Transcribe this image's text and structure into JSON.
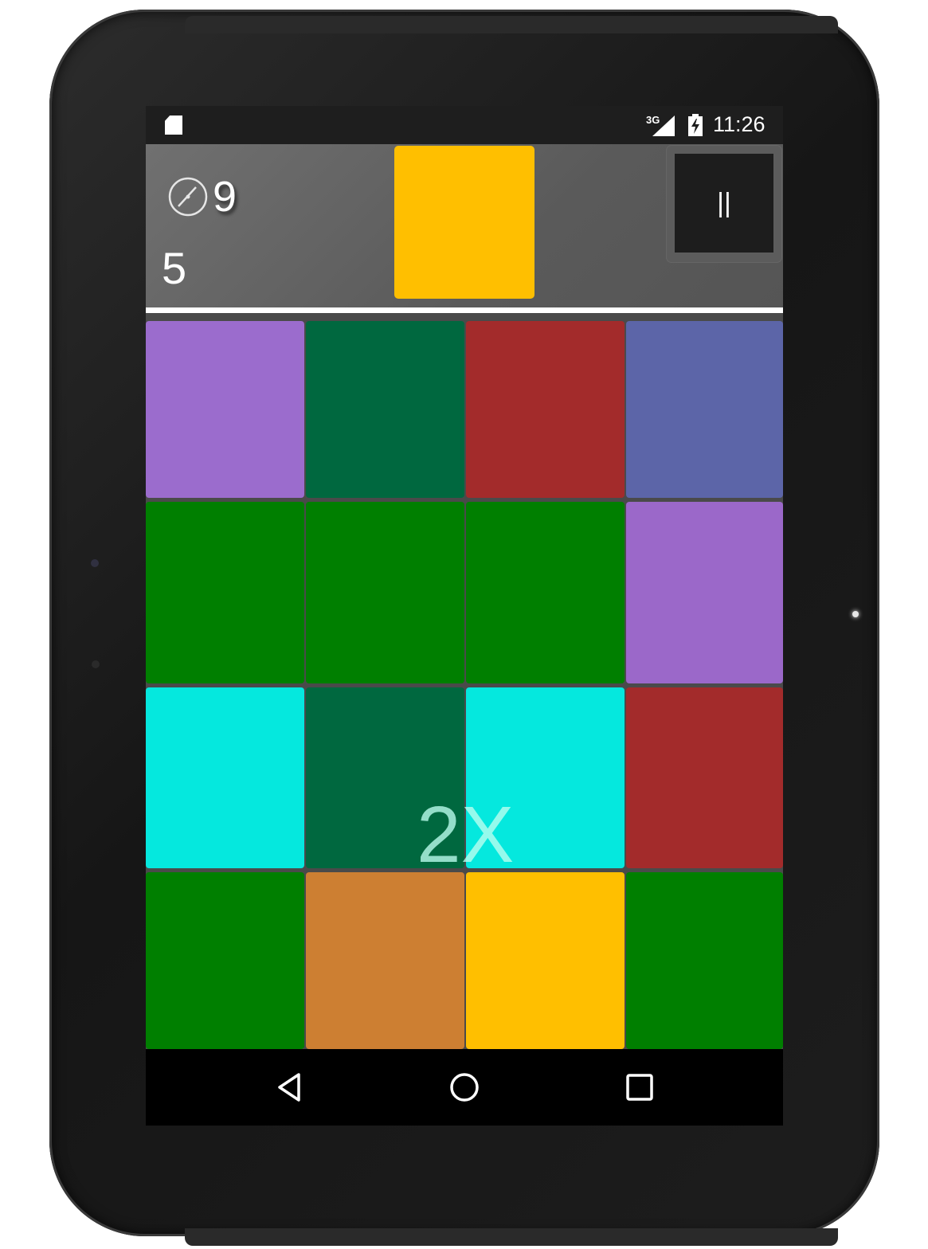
{
  "status_bar": {
    "network": "3G",
    "time": "11:26"
  },
  "header": {
    "timer_value": "9",
    "score_value": "5",
    "target_color": "#ffbf00",
    "pause_label": "||"
  },
  "grid": {
    "rows": [
      [
        "#9b6ccd",
        "#00683f",
        "#a32b2b",
        "#5c65a8"
      ],
      [
        "#007f00",
        "#007f00",
        "#007f00",
        "#9b68c9"
      ],
      [
        "#05e8de",
        "#00683f",
        "#05e8de",
        "#a32b2b"
      ],
      [
        "#007f00",
        "#cd7f32",
        "#ffbf00",
        "#007f00"
      ]
    ]
  },
  "multiplier": "2X",
  "nav": {
    "back_icon": "back-triangle-icon",
    "home_icon": "home-circle-icon",
    "recents_icon": "recents-square-icon"
  }
}
